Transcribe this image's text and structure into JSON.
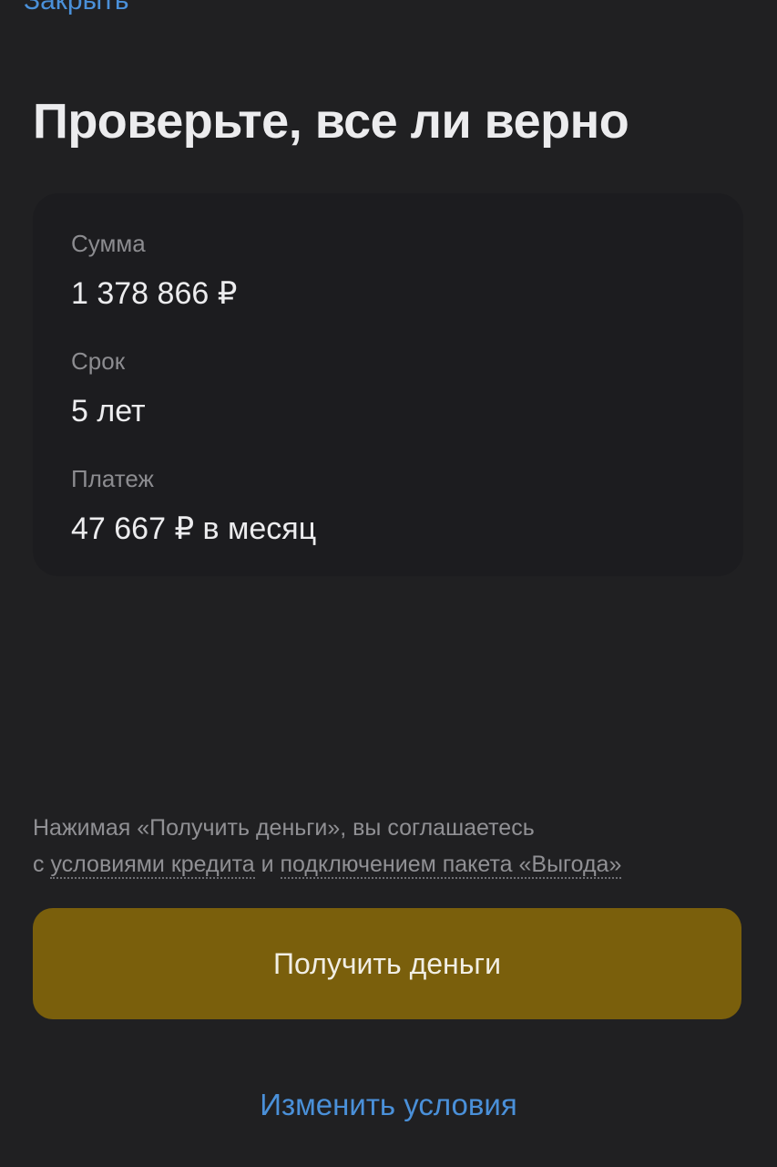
{
  "header": {
    "close_label": "Закрыть"
  },
  "title": "Проверьте, все ли верно",
  "summary": {
    "amount": {
      "label": "Сумма",
      "value": "1 378 866 ₽"
    },
    "term": {
      "label": "Срок",
      "value": "5 лет"
    },
    "payment": {
      "label": "Платеж",
      "value": "47 667 ₽ в месяц"
    }
  },
  "consent": {
    "line1": "Нажимая «Получить деньги», вы соглашаетесь",
    "prefix": "с ",
    "credit_terms_link": "условиями кредита",
    "middle": " и ",
    "package_link": "подключением пакета «Выгода»"
  },
  "actions": {
    "primary_label": "Получить деньги",
    "secondary_label": "Изменить условия"
  },
  "colors": {
    "background": "#202022",
    "accent_link": "#4a90d9",
    "primary_button": "#7a5f0c"
  }
}
